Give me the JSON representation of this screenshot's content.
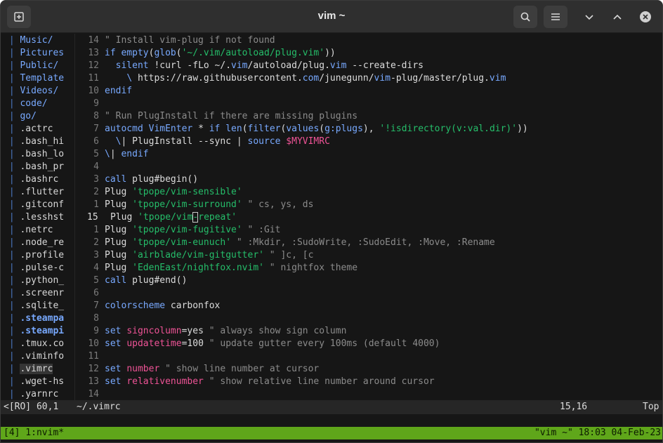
{
  "window": {
    "title": "vim ~"
  },
  "tree": {
    "items": [
      {
        "name": "Music/",
        "kind": "dir"
      },
      {
        "name": "Pictures",
        "kind": "dir"
      },
      {
        "name": "Public/",
        "kind": "dir"
      },
      {
        "name": "Template",
        "kind": "dir"
      },
      {
        "name": "Videos/",
        "kind": "dir"
      },
      {
        "name": "code/",
        "kind": "dir"
      },
      {
        "name": "go/",
        "kind": "dir"
      },
      {
        "name": ".actrc",
        "kind": "file"
      },
      {
        "name": ".bash_hi",
        "kind": "file"
      },
      {
        "name": ".bash_lo",
        "kind": "file"
      },
      {
        "name": ".bash_pr",
        "kind": "file"
      },
      {
        "name": ".bashrc",
        "kind": "file"
      },
      {
        "name": ".flutter",
        "kind": "file"
      },
      {
        "name": ".gitconf",
        "kind": "file"
      },
      {
        "name": ".lesshst",
        "kind": "file"
      },
      {
        "name": ".netrc",
        "kind": "file"
      },
      {
        "name": ".node_re",
        "kind": "file"
      },
      {
        "name": ".profile",
        "kind": "file"
      },
      {
        "name": ".pulse-c",
        "kind": "file"
      },
      {
        "name": ".python_",
        "kind": "file"
      },
      {
        "name": ".screenr",
        "kind": "file"
      },
      {
        "name": ".sqlite_",
        "kind": "file"
      },
      {
        "name": ".steampa",
        "kind": "bold"
      },
      {
        "name": ".steampi",
        "kind": "bold"
      },
      {
        "name": ".tmux.co",
        "kind": "file"
      },
      {
        "name": ".viminfo",
        "kind": "file"
      },
      {
        "name": ".vimrc",
        "kind": "file",
        "selected": true
      },
      {
        "name": ".wget-hs",
        "kind": "file"
      },
      {
        "name": ".yarnrc",
        "kind": "file"
      }
    ]
  },
  "code": {
    "lines": [
      {
        "n": "14",
        "tokens": [
          [
            "t-cmt",
            "\" Install vim-plug if not found"
          ]
        ]
      },
      {
        "n": "13",
        "tokens": [
          [
            "t-kw",
            "if "
          ],
          [
            "t-fn",
            "empty"
          ],
          [
            "t-txt",
            "("
          ],
          [
            "t-fn",
            "glob"
          ],
          [
            "t-txt",
            "("
          ],
          [
            "t-str",
            "'~/.vim/autoload/plug.vim'"
          ],
          [
            "t-txt",
            "))"
          ]
        ]
      },
      {
        "n": "12",
        "tokens": [
          [
            "t-txt",
            "  "
          ],
          [
            "t-kw",
            "silent "
          ],
          [
            "t-txt",
            "!curl -fLo ~/."
          ],
          [
            "t-url1",
            "vim"
          ],
          [
            "t-txt",
            "/autoload/plug."
          ],
          [
            "t-url1",
            "vim"
          ],
          [
            "t-txt",
            " --create-dirs"
          ]
        ]
      },
      {
        "n": "11",
        "tokens": [
          [
            "t-txt",
            "    "
          ],
          [
            "t-url1",
            "\\"
          ],
          [
            "t-txt",
            " https://raw.githubusercontent."
          ],
          [
            "t-url1",
            "com"
          ],
          [
            "t-txt",
            "/junegunn/"
          ],
          [
            "t-url1",
            "vim"
          ],
          [
            "t-txt",
            "-plug/master/plug."
          ],
          [
            "t-url1",
            "vim"
          ]
        ]
      },
      {
        "n": "10",
        "tokens": [
          [
            "t-kw",
            "endif"
          ]
        ]
      },
      {
        "n": "9",
        "tokens": []
      },
      {
        "n": "8",
        "tokens": [
          [
            "t-cmt",
            "\" Run PlugInstall if there are missing plugins"
          ]
        ]
      },
      {
        "n": "7",
        "tokens": [
          [
            "t-kw",
            "autocmd "
          ],
          [
            "t-fn",
            "VimEnter"
          ],
          [
            "t-txt",
            " * "
          ],
          [
            "t-kw",
            "if "
          ],
          [
            "t-fn",
            "len"
          ],
          [
            "t-txt",
            "("
          ],
          [
            "t-fn",
            "filter"
          ],
          [
            "t-txt",
            "("
          ],
          [
            "t-fn",
            "values"
          ],
          [
            "t-txt",
            "("
          ],
          [
            "t-fn",
            "g:plugs"
          ],
          [
            "t-txt",
            "), "
          ],
          [
            "t-str",
            "'!isdirectory(v:val.dir)'"
          ],
          [
            "t-txt",
            "))"
          ]
        ]
      },
      {
        "n": "6",
        "tokens": [
          [
            "t-txt",
            "  "
          ],
          [
            "t-url1",
            "\\"
          ],
          [
            "t-txt",
            "| PlugInstall --sync | "
          ],
          [
            "t-kw",
            "source "
          ],
          [
            "t-var",
            "$MYVIMRC"
          ]
        ]
      },
      {
        "n": "5",
        "tokens": [
          [
            "t-url1",
            "\\"
          ],
          [
            "t-txt",
            "| "
          ],
          [
            "t-kw",
            "endif"
          ]
        ]
      },
      {
        "n": "4",
        "tokens": []
      },
      {
        "n": "3",
        "tokens": [
          [
            "t-kw",
            "call "
          ],
          [
            "t-txt",
            "plug#begin()"
          ]
        ]
      },
      {
        "n": "2",
        "tokens": [
          [
            "t-txt",
            "Plug "
          ],
          [
            "t-str",
            "'tpope/vim-sensible'"
          ]
        ]
      },
      {
        "n": "1",
        "tokens": [
          [
            "t-txt",
            "Plug "
          ],
          [
            "t-str",
            "'tpope/vim-surround'"
          ],
          [
            "t-cmt",
            " \" cs, ys, ds"
          ]
        ]
      },
      {
        "n": "15",
        "current": true,
        "tokens": [
          [
            "t-txt",
            "Plug "
          ],
          [
            "t-str",
            "'tpope/vim"
          ],
          [
            "t-str cur-box",
            "-"
          ],
          [
            "t-str",
            "repeat'"
          ]
        ]
      },
      {
        "n": "1",
        "tokens": [
          [
            "t-txt",
            "Plug "
          ],
          [
            "t-str",
            "'tpope/vim-fugitive'"
          ],
          [
            "t-cmt",
            " \" :Git"
          ]
        ]
      },
      {
        "n": "2",
        "tokens": [
          [
            "t-txt",
            "Plug "
          ],
          [
            "t-str",
            "'tpope/vim-eunuch'"
          ],
          [
            "t-cmt",
            " \" :Mkdir, :SudoWrite, :SudoEdit, :Move, :Rename"
          ]
        ]
      },
      {
        "n": "3",
        "tokens": [
          [
            "t-txt",
            "Plug "
          ],
          [
            "t-str",
            "'airblade/vim-gitgutter'"
          ],
          [
            "t-cmt",
            " \" ]c, [c"
          ]
        ]
      },
      {
        "n": "4",
        "tokens": [
          [
            "t-txt",
            "Plug "
          ],
          [
            "t-str",
            "'EdenEast/nightfox.nvim'"
          ],
          [
            "t-cmt",
            " \" nightfox theme"
          ]
        ]
      },
      {
        "n": "5",
        "tokens": [
          [
            "t-kw",
            "call "
          ],
          [
            "t-txt",
            "plug#end()"
          ]
        ]
      },
      {
        "n": "6",
        "tokens": []
      },
      {
        "n": "7",
        "tokens": [
          [
            "t-kw",
            "colorscheme "
          ],
          [
            "t-txt",
            "carbonfox"
          ]
        ]
      },
      {
        "n": "8",
        "tokens": []
      },
      {
        "n": "9",
        "tokens": [
          [
            "t-kw",
            "set "
          ],
          [
            "t-var",
            "signcolumn"
          ],
          [
            "t-txt",
            "=yes"
          ],
          [
            "t-cmt",
            " \" always show sign column"
          ]
        ]
      },
      {
        "n": "10",
        "tokens": [
          [
            "t-kw",
            "set "
          ],
          [
            "t-var",
            "updatetime"
          ],
          [
            "t-txt",
            "=100"
          ],
          [
            "t-cmt",
            " \" update gutter every 100ms (default 4000)"
          ]
        ]
      },
      {
        "n": "11",
        "tokens": []
      },
      {
        "n": "12",
        "tokens": [
          [
            "t-kw",
            "set "
          ],
          [
            "t-var",
            "number"
          ],
          [
            "t-cmt",
            " \" show line number at cursor"
          ]
        ]
      },
      {
        "n": "13",
        "tokens": [
          [
            "t-kw",
            "set "
          ],
          [
            "t-var",
            "relativenumber"
          ],
          [
            "t-cmt",
            " \" show relative line number around cursor"
          ]
        ]
      },
      {
        "n": "14",
        "tokens": []
      }
    ]
  },
  "statusline": {
    "left": "<[RO] 60,1",
    "file": "~/.vimrc",
    "position": "15,16",
    "scroll": "Top"
  },
  "tmux": {
    "left": "[4] 1:nvim*",
    "right": "\"vim ~\" 18:03 04-Feb-23"
  },
  "icons": {
    "new_tab": "new-tab-icon",
    "search": "search-icon",
    "menu": "hamburger-menu-icon",
    "minimize": "chevron-down-icon",
    "maximize": "chevron-up-icon",
    "close": "close-icon"
  }
}
